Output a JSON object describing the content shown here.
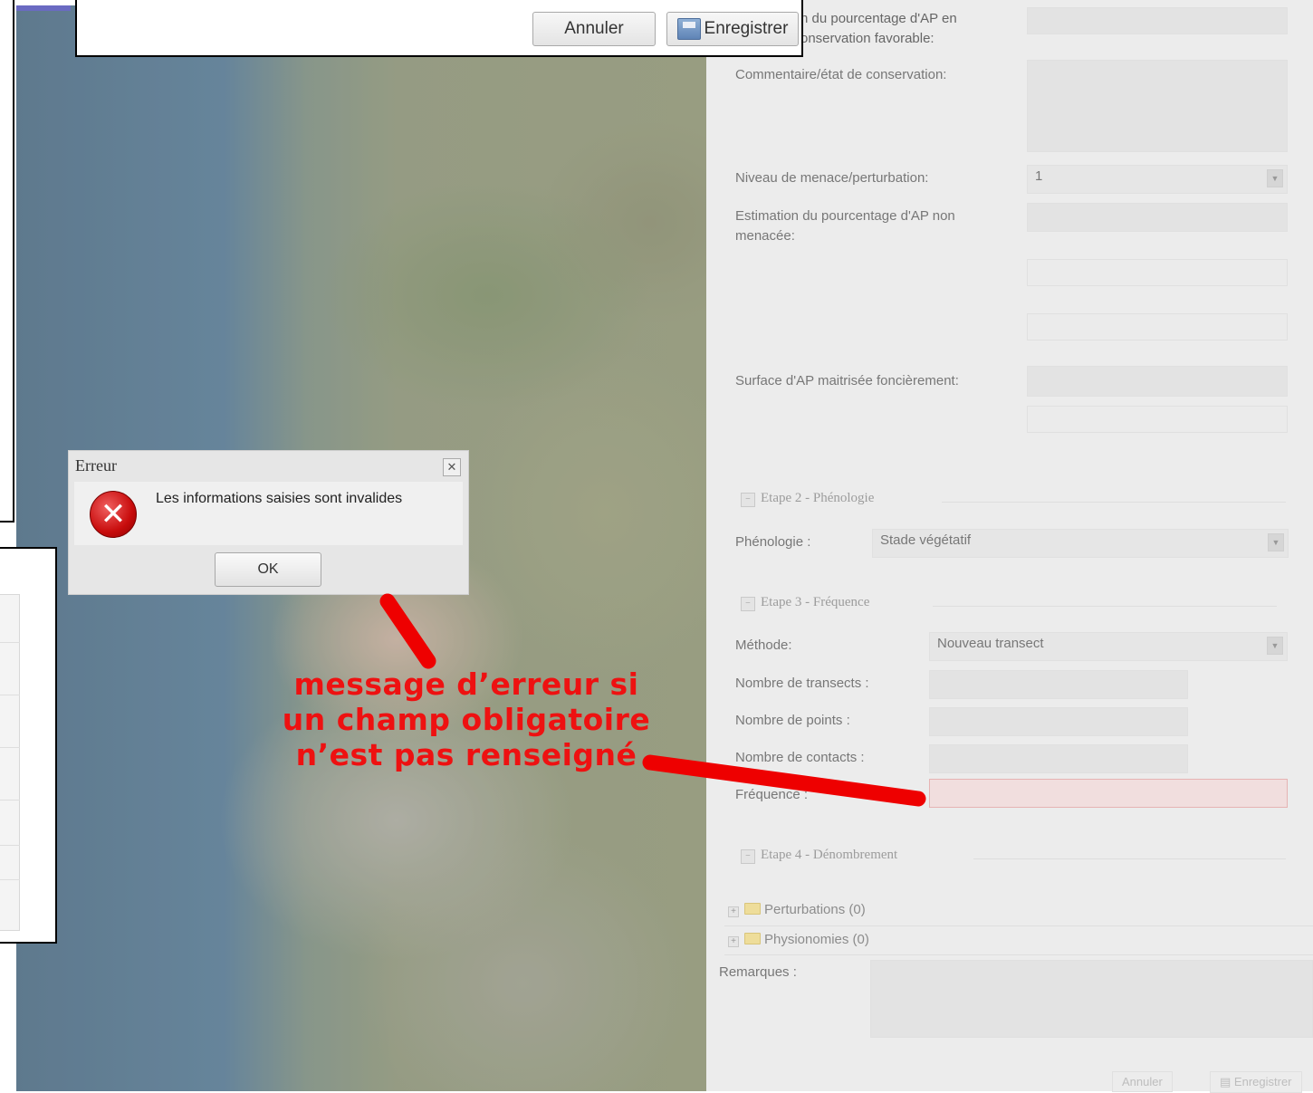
{
  "top_dialog": {
    "cancel_label": "Annuler",
    "save_label": "Enregistrer"
  },
  "form": {
    "partial_top_label_line1": "n du pourcentage d'AP en",
    "partial_top_label_line2": "onservation favorable:",
    "comment_label": "Commentaire/état de conservation:",
    "menace_label": "Niveau de menace/perturbation:",
    "menace_value": "1",
    "estimation_label_line1": "Estimation du pourcentage d'AP non",
    "estimation_label_line2": "menacée:",
    "surface_label": "Surface d'AP maitrisée foncièrement:",
    "etape2_label": "Etape 2 - Phénologie",
    "phenologie_label": "Phénologie :",
    "phenologie_value": "Stade végétatif",
    "etape3_label": "Etape 3 - Fréquence",
    "methode_label": "Méthode:",
    "methode_value": "Nouveau transect",
    "transects_label": "Nombre de transects :",
    "points_label": "Nombre de points :",
    "contacts_label": "Nombre de contacts :",
    "frequence_label": "Fréquence :",
    "etape4_label": "Etape 4 - Dénombrement",
    "perturbations_label": "Perturbations (0)",
    "physionomies_label": "Physionomies (0)",
    "remarques_label": "Remarques :",
    "bottom_cancel_label": "Annuler",
    "bottom_save_label": "Enregistrer"
  },
  "error_dialog": {
    "title": "Erreur",
    "message": "Les informations saisies sont invalides",
    "ok_label": "OK"
  },
  "annotation": {
    "line1": "message d’erreur si",
    "line2": "un champ obligatoire",
    "line3": "n’est pas renseigné"
  },
  "colors": {
    "annotation_red": "#ee1111",
    "error_field_bg": "#f1dede"
  },
  "icons": {
    "error": "error-circle-x-icon",
    "close": "close-icon",
    "save": "floppy-disk-icon",
    "folder": "folder-icon"
  }
}
